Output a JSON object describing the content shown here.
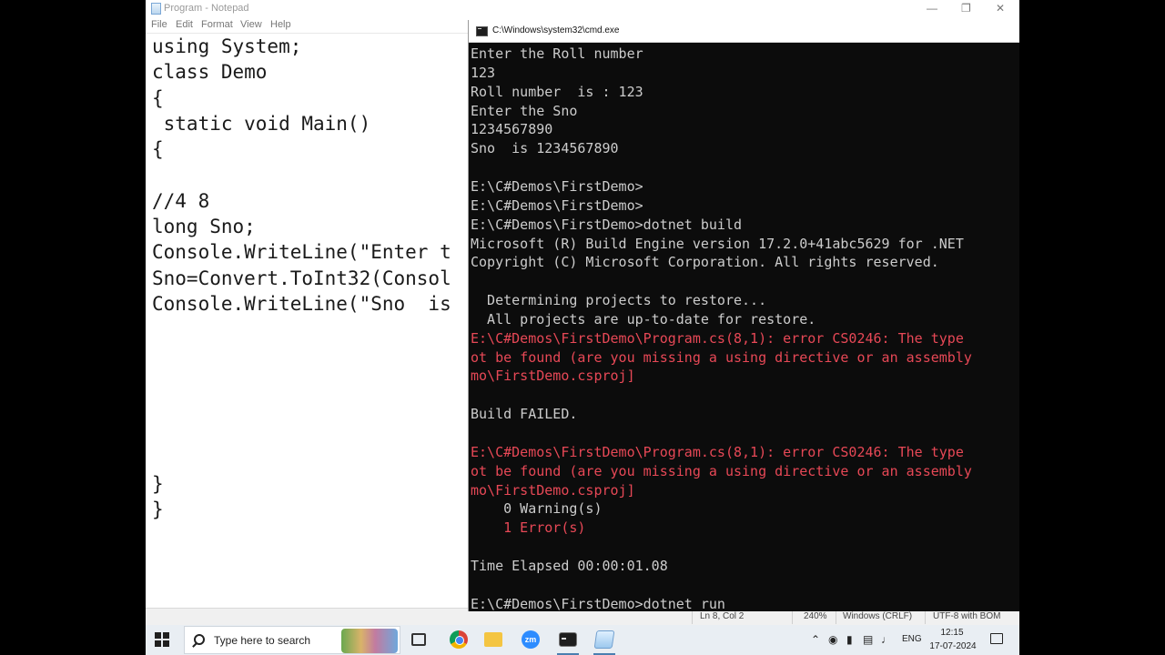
{
  "notepad": {
    "title": "Program - Notepad",
    "menu": [
      "File",
      "Edit",
      "Format",
      "View",
      "Help"
    ],
    "code_lines": [
      "using System;",
      "class Demo",
      "{",
      " static void Main()",
      "{",
      "",
      "//4 8",
      "long Sno;",
      "Console.WriteLine(\"Enter t",
      "Sno=Convert.ToInt32(Consol",
      "Console.WriteLine(\"Sno  is",
      "",
      "",
      "",
      "",
      "",
      "",
      "}",
      "}"
    ],
    "status": {
      "position": "Ln 8, Col 2",
      "zoom": "240%",
      "line_ending": "Windows (CRLF)",
      "encoding": "UTF-8 with BOM"
    }
  },
  "cmd": {
    "title": "C:\\Windows\\system32\\cmd.exe",
    "lines": [
      {
        "text": "Enter the Roll number",
        "error": false
      },
      {
        "text": "123",
        "error": false
      },
      {
        "text": "Roll number  is : 123",
        "error": false
      },
      {
        "text": "Enter the Sno",
        "error": false
      },
      {
        "text": "1234567890",
        "error": false
      },
      {
        "text": "Sno  is 1234567890",
        "error": false
      },
      {
        "text": "",
        "error": false
      },
      {
        "text": "E:\\C#Demos\\FirstDemo>",
        "error": false
      },
      {
        "text": "E:\\C#Demos\\FirstDemo>",
        "error": false
      },
      {
        "text": "E:\\C#Demos\\FirstDemo>dotnet build",
        "error": false
      },
      {
        "text": "Microsoft (R) Build Engine version 17.2.0+41abc5629 for .NET",
        "error": false
      },
      {
        "text": "Copyright (C) Microsoft Corporation. All rights reserved.",
        "error": false
      },
      {
        "text": "",
        "error": false
      },
      {
        "text": "  Determining projects to restore...",
        "error": false
      },
      {
        "text": "  All projects are up-to-date for restore.",
        "error": false
      },
      {
        "text": "E:\\C#Demos\\FirstDemo\\Program.cs(8,1): error CS0246: The type",
        "error": true
      },
      {
        "text": "ot be found (are you missing a using directive or an assembly",
        "error": true
      },
      {
        "text": "mo\\FirstDemo.csproj]",
        "error": true
      },
      {
        "text": "",
        "error": false
      },
      {
        "text": "Build FAILED.",
        "error": false
      },
      {
        "text": "",
        "error": false
      },
      {
        "text": "E:\\C#Demos\\FirstDemo\\Program.cs(8,1): error CS0246: The type",
        "error": true
      },
      {
        "text": "ot be found (are you missing a using directive or an assembly",
        "error": true
      },
      {
        "text": "mo\\FirstDemo.csproj]",
        "error": true
      },
      {
        "text": "    0 Warning(s)",
        "error": false
      },
      {
        "text": "    1 Error(s)",
        "error": true
      },
      {
        "text": "",
        "error": false
      },
      {
        "text": "Time Elapsed 00:00:01.08",
        "error": false
      },
      {
        "text": "",
        "error": false
      },
      {
        "text": "E:\\C#Demos\\FirstDemo>dotnet run",
        "error": false
      }
    ]
  },
  "taskbar": {
    "search_placeholder": "Type here to search",
    "zoom_label": "zm",
    "language": "ENG",
    "time": "12:15",
    "date": "17-07-2024"
  },
  "colors": {
    "terminal_bg": "#0c0c0c",
    "terminal_text": "#cccccc",
    "terminal_error": "#e74856",
    "taskbar_bg": "#e9eef3"
  }
}
